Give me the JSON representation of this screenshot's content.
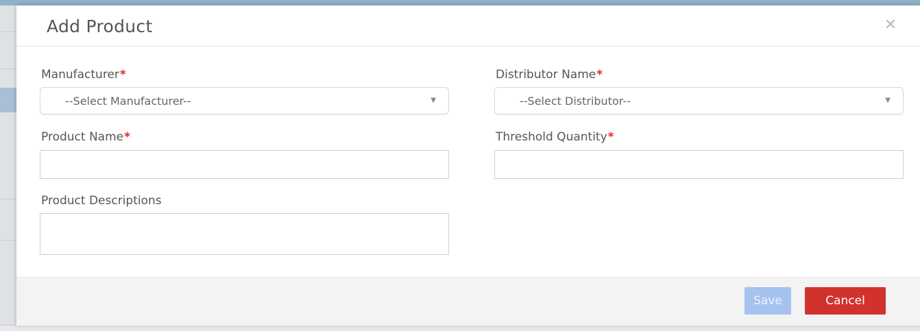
{
  "modal": {
    "title": "Add Product",
    "close_icon": "close-icon"
  },
  "form": {
    "manufacturer": {
      "label": "Manufacturer",
      "required_mark": "*",
      "selected": "--Select Manufacturer--"
    },
    "distributor": {
      "label": "Distributor Name",
      "required_mark": "*",
      "selected": "--Select Distributor--"
    },
    "product_name": {
      "label": "Product Name",
      "required_mark": "*",
      "value": ""
    },
    "threshold_quantity": {
      "label": "Threshold Quantity",
      "required_mark": "*",
      "value": ""
    },
    "product_descriptions": {
      "label": "Product Descriptions",
      "value": ""
    }
  },
  "footer": {
    "save_label": "Save",
    "cancel_label": "Cancel"
  },
  "colors": {
    "required": "#e0242d",
    "save_button": "#a6c2ee",
    "cancel_button": "#d2322d",
    "footer_bg": "#f3f3f3"
  }
}
